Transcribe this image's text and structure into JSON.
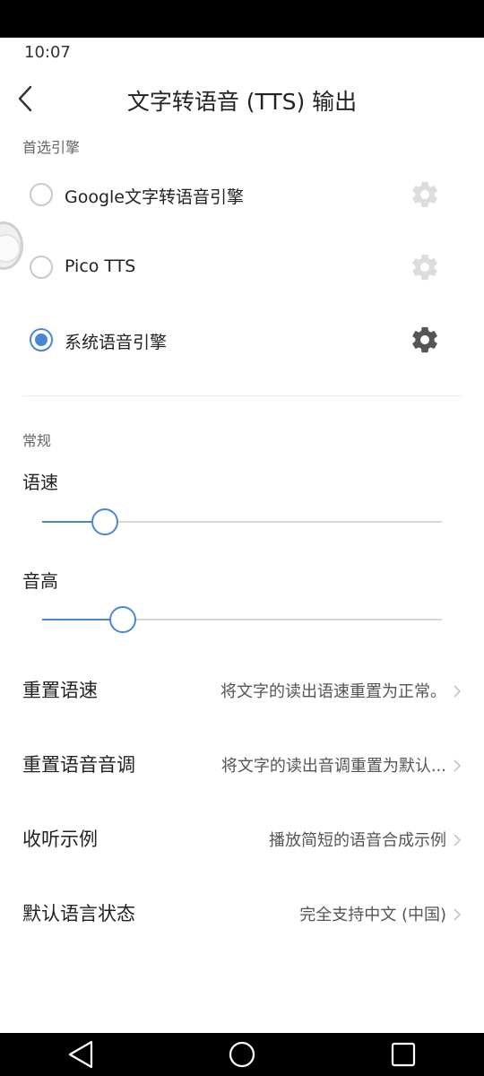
{
  "status_bar": {
    "time": "10:07"
  },
  "header": {
    "title": "文字转语音 (TTS) 输出"
  },
  "engines": {
    "section_label": "首选引擎",
    "items": [
      {
        "label": "Google文字转语音引擎",
        "checked": false,
        "settings_enabled": false
      },
      {
        "label": "Pico TTS",
        "checked": false,
        "settings_enabled": false
      },
      {
        "label": "系统语音引擎",
        "checked": true,
        "settings_enabled": true
      }
    ]
  },
  "general": {
    "section_label": "常规",
    "speech_rate": {
      "label": "语速",
      "value": 0.156
    },
    "pitch": {
      "label": "音高",
      "value": 0.202
    }
  },
  "prefs": [
    {
      "title": "重置语速",
      "summary": "将文字的读出语速重置为正常。"
    },
    {
      "title": "重置语音音调",
      "summary": "将文字的读出音调重置为默认..."
    },
    {
      "title": "收听示例",
      "summary": "播放简短的语音合成示例"
    },
    {
      "title": "默认语言状态",
      "summary": "完全支持中文 (中国)"
    }
  ],
  "colors": {
    "accent": "#4a86d8",
    "gear_active": "#555555",
    "gear_disabled": "#dddddd"
  },
  "icons": {
    "back": "chevron-left-icon",
    "settings": "gear-icon",
    "chevron": "chevron-right-icon"
  }
}
